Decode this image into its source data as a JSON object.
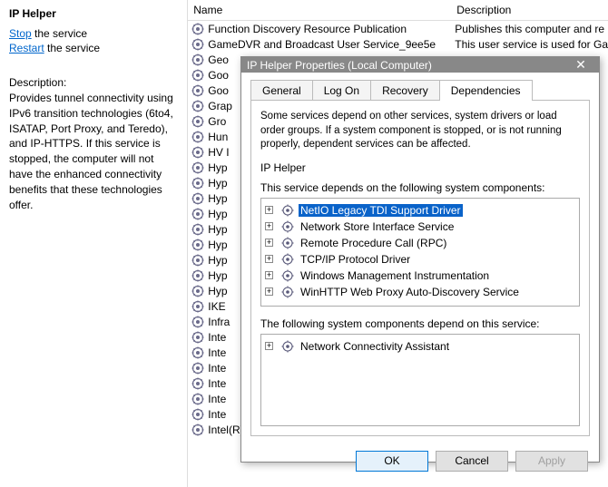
{
  "left": {
    "title": "IP Helper",
    "stop_link": "Stop",
    "stop_suffix": " the service",
    "restart_link": "Restart",
    "restart_suffix": " the service",
    "desc_label": "Description:",
    "desc_text": "Provides tunnel connectivity using IPv6 transition technologies (6to4, ISATAP, Port Proxy, and Teredo), and IP-HTTPS. If this service is stopped, the computer will not have the enhanced connectivity benefits that these technologies offer."
  },
  "columns": {
    "name": "Name",
    "desc": "Description"
  },
  "services": [
    {
      "name": "Function Discovery Resource Publication",
      "desc": "Publishes this computer and re"
    },
    {
      "name": "GameDVR and Broadcast User Service_9ee5e",
      "desc": "This user service is used for Ga"
    },
    {
      "name": "Geo",
      "desc": ""
    },
    {
      "name": "Goo",
      "desc": ""
    },
    {
      "name": "Goo",
      "desc": ""
    },
    {
      "name": "Grap",
      "desc": ""
    },
    {
      "name": "Gro",
      "desc": ""
    },
    {
      "name": "Hun",
      "desc": ""
    },
    {
      "name": "HV I",
      "desc": ""
    },
    {
      "name": "Hyp",
      "desc": ""
    },
    {
      "name": "Hyp",
      "desc": ""
    },
    {
      "name": "Hyp",
      "desc": ""
    },
    {
      "name": "Hyp",
      "desc": ""
    },
    {
      "name": "Hyp",
      "desc": ""
    },
    {
      "name": "Hyp",
      "desc": ""
    },
    {
      "name": "Hyp",
      "desc": ""
    },
    {
      "name": "Hyp",
      "desc": ""
    },
    {
      "name": "Hyp",
      "desc": ""
    },
    {
      "name": "IKE",
      "desc": ""
    },
    {
      "name": "Infra",
      "desc": ""
    },
    {
      "name": "Inte",
      "desc": ""
    },
    {
      "name": "Inte",
      "desc": ""
    },
    {
      "name": "Inte",
      "desc": ""
    },
    {
      "name": "Inte",
      "desc": ""
    },
    {
      "name": "Inte",
      "desc": ""
    },
    {
      "name": "Inte",
      "desc": ""
    },
    {
      "name": "Intel(R) Security Assist Helper",
      "desc": ""
    }
  ],
  "dialog": {
    "title": "IP Helper Properties (Local Computer)",
    "tabs": [
      "General",
      "Log On",
      "Recovery",
      "Dependencies"
    ],
    "active_tab": 3,
    "intro": "Some services depend on other services, system drivers or load order groups. If a system component is stopped, or is not running properly, dependent services can be affected.",
    "service_name": "IP Helper",
    "depends_on_label": "This service depends on the following system components:",
    "depends_on": [
      {
        "label": "NetIO Legacy TDI Support Driver",
        "selected": true
      },
      {
        "label": "Network Store Interface Service"
      },
      {
        "label": "Remote Procedure Call (RPC)"
      },
      {
        "label": "TCP/IP Protocol Driver"
      },
      {
        "label": "Windows Management Instrumentation"
      },
      {
        "label": "WinHTTP Web Proxy Auto-Discovery Service"
      }
    ],
    "dependent_label": "The following system components depend on this service:",
    "dependent": [
      {
        "label": "Network Connectivity Assistant"
      }
    ],
    "buttons": {
      "ok": "OK",
      "cancel": "Cancel",
      "apply": "Apply"
    }
  }
}
